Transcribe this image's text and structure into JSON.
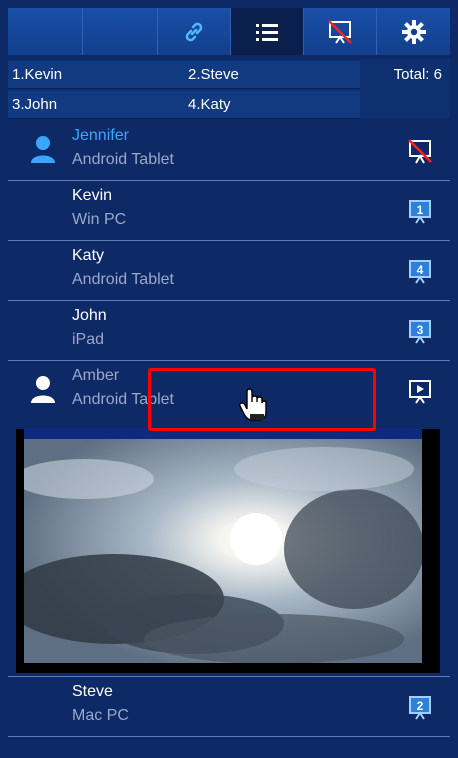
{
  "toolbar": {
    "icons": [
      "link-icon",
      "list-icon",
      "no-display-icon",
      "gear-icon"
    ],
    "active": "list-icon"
  },
  "queue": {
    "items": [
      "1.Kevin",
      "2.Steve",
      "3.John",
      "4.Katy"
    ],
    "total": "Total: 6"
  },
  "users": [
    {
      "name": "Jennifer",
      "device": "Android Tablet",
      "status": "no-display-icon"
    },
    {
      "name": "Kevin",
      "device": "Win PC",
      "status": "1"
    },
    {
      "name": "Katy",
      "device": "Android Tablet",
      "status": "4"
    },
    {
      "name": "John",
      "device": "iPad",
      "status": "3"
    },
    {
      "name": "Amber",
      "device": "Android Tablet",
      "status": "play-icon"
    },
    {
      "name": "Steve",
      "device": "Mac PC",
      "status": "2"
    }
  ],
  "colors": {
    "background": "#0d2a66",
    "toolbar": "#1a4fa8",
    "active_name": "#3aa7ff",
    "highlight": "#ff0000"
  }
}
